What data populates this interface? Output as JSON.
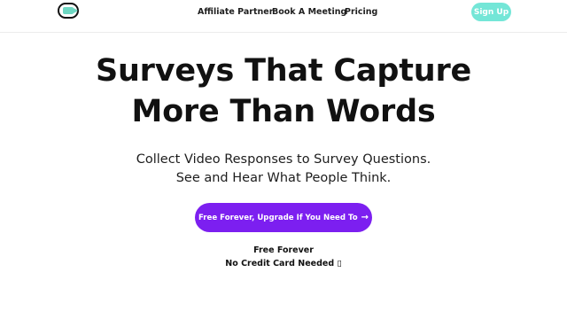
{
  "header": {
    "logo_icon": "video-camera-icon",
    "nav": {
      "affiliate": "Affiliate Partner",
      "meeting": "Book A Meeting",
      "pricing": "Pricing"
    },
    "signup_label": "Sign Up"
  },
  "hero": {
    "title_line1": "Surveys That Capture",
    "title_line2": "More Than Words",
    "subtitle_line1": "Collect Video Responses to Survey Questions.",
    "subtitle_line2": "See and Hear What People Think.",
    "cta_label": "Free Forever, Upgrade If You Need To",
    "cta_arrow": "→",
    "note_line1": "Free Forever",
    "note_line2": "No Credit Card Needed ▯"
  },
  "colors": {
    "accent": "#7c1ff0",
    "signup": "#74e6d7",
    "logo": "#6ed7c2"
  }
}
